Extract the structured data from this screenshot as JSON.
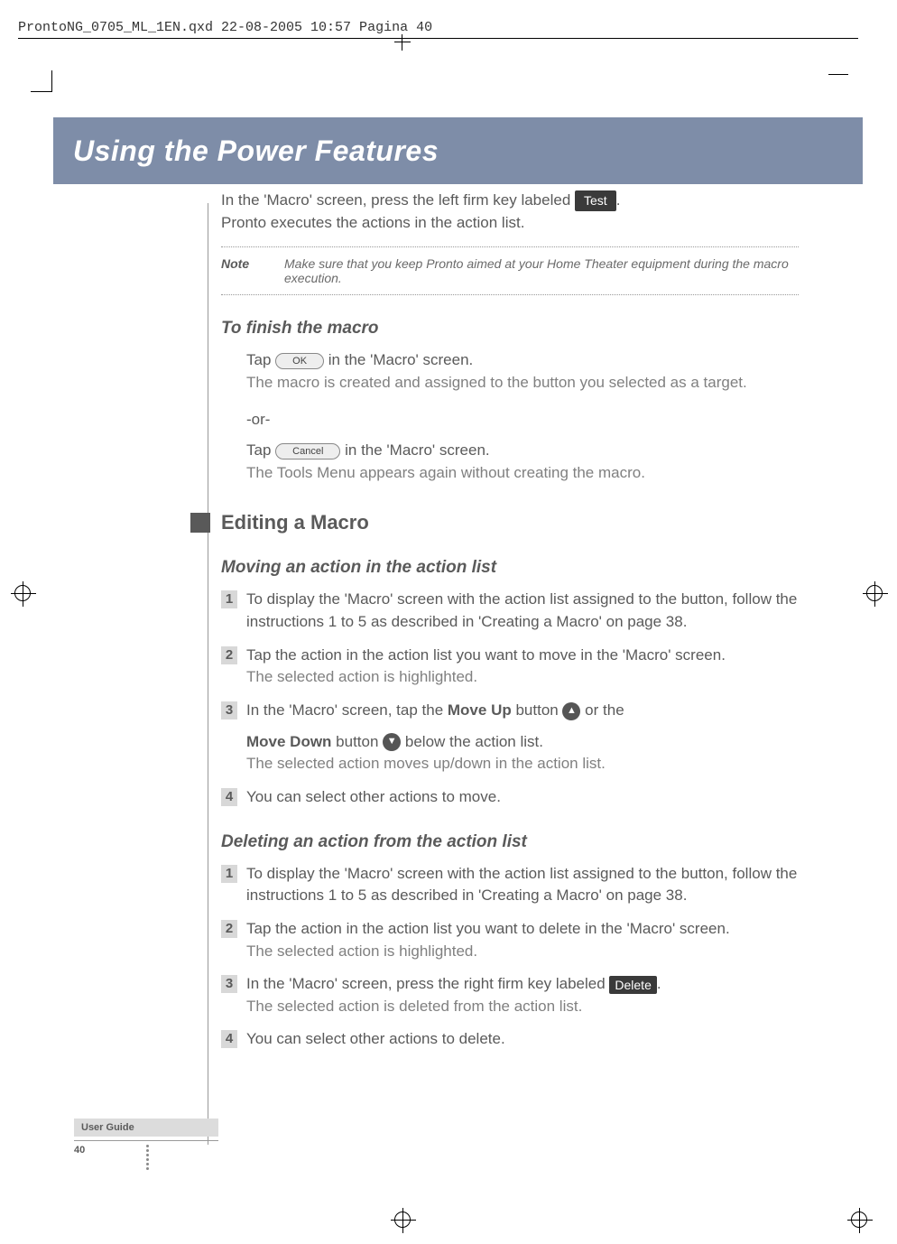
{
  "header_line": "ProntoNG_0705_ML_1EN.qxd  22-08-2005  10:57  Pagina 40",
  "banner_title": "Using the Power Features",
  "intro": {
    "line1a": "In the 'Macro' screen, press the left firm key labeled ",
    "test_chip": "Test",
    "line1b": ".",
    "line2": "Pronto executes the actions in the action list."
  },
  "note": {
    "label": "Note",
    "body": "Make sure that you keep Pronto aimed at your Home Theater equipment during the macro execution."
  },
  "finish": {
    "heading": "To finish the macro",
    "tap_ok_a": "Tap ",
    "ok": "OK",
    "tap_ok_b": " in the 'Macro' screen.",
    "ok_result": "The macro is created and assigned to the button you selected as a target.",
    "or": "-or-",
    "tap_cancel_a": "Tap ",
    "cancel": "Cancel",
    "tap_cancel_b": " in the 'Macro' screen.",
    "cancel_result": "The Tools Menu appears again without creating the macro."
  },
  "editing_heading": "Editing a Macro",
  "moving": {
    "heading": "Moving an action in the action list",
    "s1": "To display the 'Macro' screen with the action list assigned to the button, follow the instructions 1 to 5 as described in 'Creating a Macro' on page 38.",
    "s2a": "Tap the action in the action list you want to move in the 'Macro' screen.",
    "s2b": "The selected action is highlighted.",
    "s3a": "In the 'Macro' screen, tap the ",
    "moveup": "Move Up",
    "s3b": " button ",
    "s3c": " or the",
    "s3d_prefix": "",
    "movedown": "Move Down",
    "s3e": " button ",
    "s3f": " below the action list.",
    "s3g": "The selected action moves up/down in the action list.",
    "s4": "You can select other actions to move."
  },
  "deleting": {
    "heading": "Deleting an action from the action list",
    "s1": "To display the 'Macro' screen with the action list assigned to the button, follow the instructions 1 to 5 as described in 'Creating a Macro' on page 38.",
    "s2a": "Tap the action in the action list you want to delete in the 'Macro' screen.",
    "s2b": "The selected action is highlighted.",
    "s3a": "In the 'Macro' screen, press the right firm key labeled ",
    "delete": "Delete",
    "s3b": ".",
    "s3c": "The selected action is deleted from the action list.",
    "s4": "You can select other actions to delete."
  },
  "footer": {
    "user_guide": "User Guide",
    "page": "40"
  },
  "icons": {
    "up": "▲",
    "down": "▼"
  }
}
